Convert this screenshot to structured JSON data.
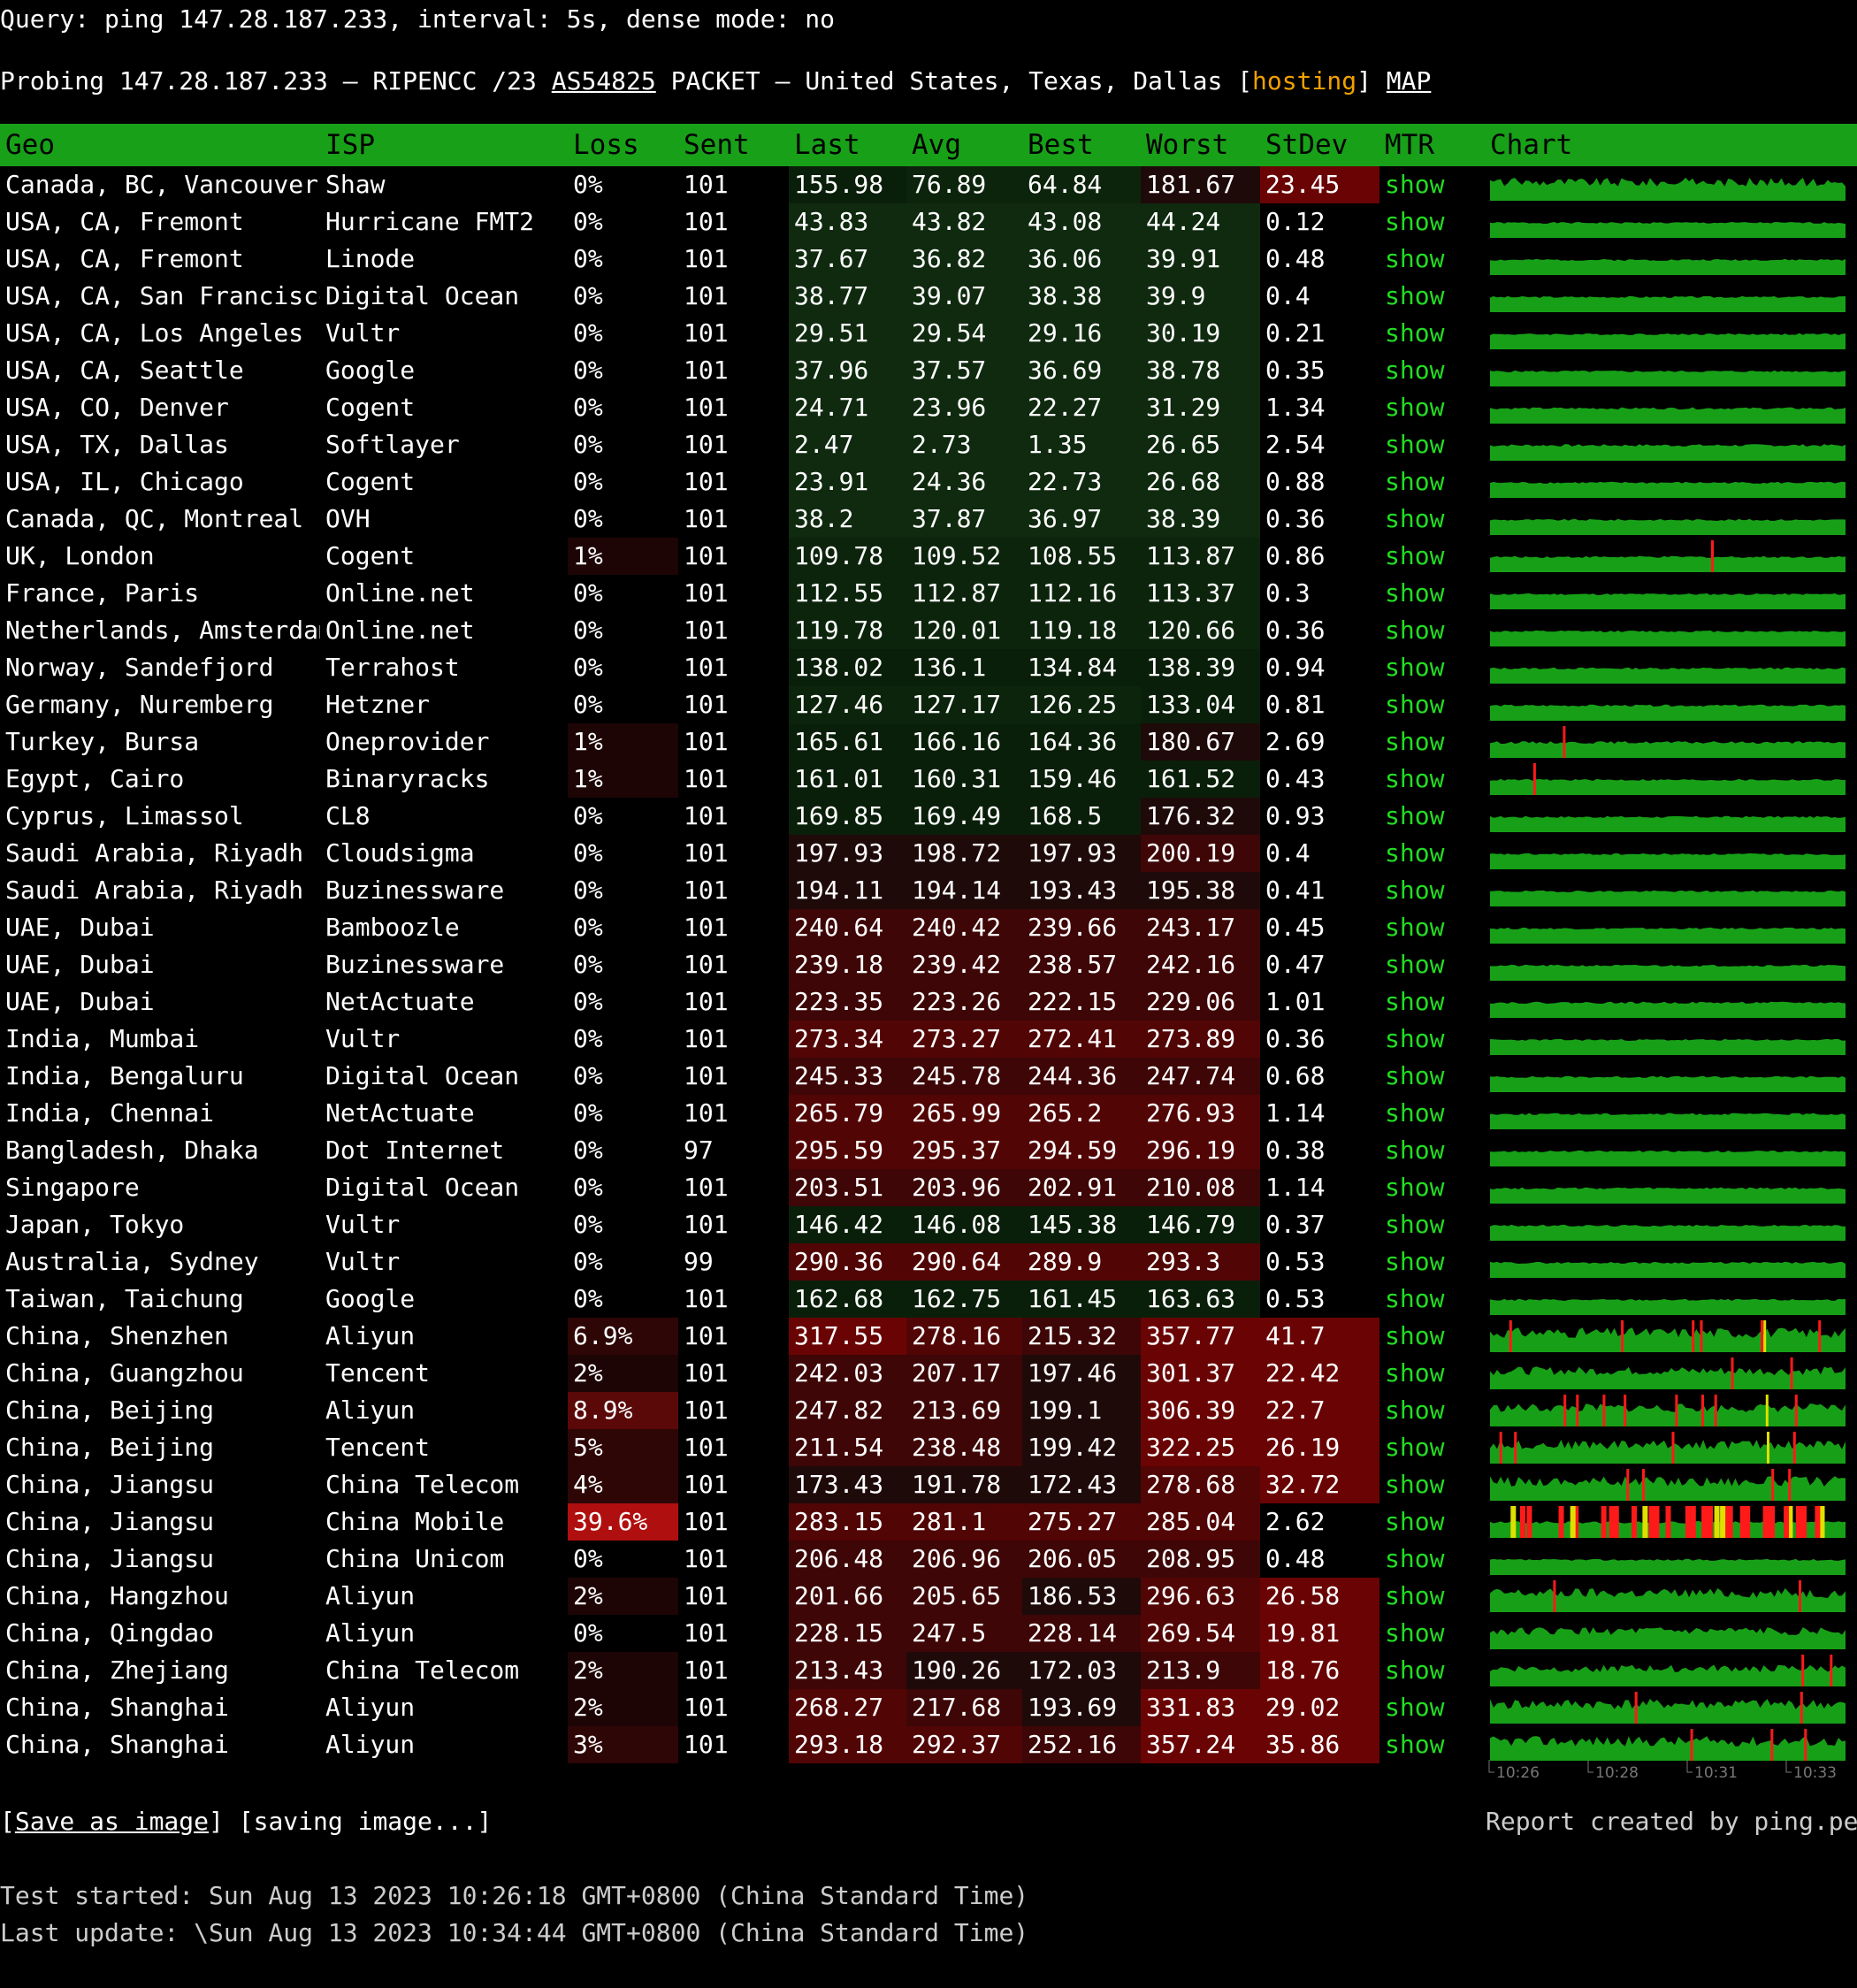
{
  "query": "Query: ping 147.28.187.233, interval: 5s, dense mode: no",
  "probe": {
    "prefix": "Probing 147.28.187.233 – RIPENCC /23 ",
    "asn": "AS54825",
    "middle": " PACKET – United States, Texas, Dallas [",
    "tag": "hosting",
    "after": "] ",
    "map": "MAP"
  },
  "columns": [
    "Geo",
    "ISP",
    "Loss",
    "Sent",
    "Last",
    "Avg",
    "Best",
    "Worst",
    "StDev",
    "MTR",
    "Chart"
  ],
  "rows": [
    [
      "Canada, BC, Vancouver",
      "Shaw",
      "0%",
      "101",
      "155.98",
      "76.89",
      "64.84",
      "181.67",
      "23.45",
      "show"
    ],
    [
      "USA, CA, Fremont",
      "Hurricane FMT2",
      "0%",
      "101",
      "43.83",
      "43.82",
      "43.08",
      "44.24",
      "0.12",
      "show"
    ],
    [
      "USA, CA, Fremont",
      "Linode",
      "0%",
      "101",
      "37.67",
      "36.82",
      "36.06",
      "39.91",
      "0.48",
      "show"
    ],
    [
      "USA, CA, San Francisco",
      "Digital Ocean",
      "0%",
      "101",
      "38.77",
      "39.07",
      "38.38",
      "39.9",
      "0.4",
      "show"
    ],
    [
      "USA, CA, Los Angeles",
      "Vultr",
      "0%",
      "101",
      "29.51",
      "29.54",
      "29.16",
      "30.19",
      "0.21",
      "show"
    ],
    [
      "USA, CA, Seattle",
      "Google",
      "0%",
      "101",
      "37.96",
      "37.57",
      "36.69",
      "38.78",
      "0.35",
      "show"
    ],
    [
      "USA, CO, Denver",
      "Cogent",
      "0%",
      "101",
      "24.71",
      "23.96",
      "22.27",
      "31.29",
      "1.34",
      "show"
    ],
    [
      "USA, TX, Dallas",
      "Softlayer",
      "0%",
      "101",
      "2.47",
      "2.73",
      "1.35",
      "26.65",
      "2.54",
      "show"
    ],
    [
      "USA, IL, Chicago",
      "Cogent",
      "0%",
      "101",
      "23.91",
      "24.36",
      "22.73",
      "26.68",
      "0.88",
      "show"
    ],
    [
      "Canada, QC, Montreal",
      "OVH",
      "0%",
      "101",
      "38.2",
      "37.87",
      "36.97",
      "38.39",
      "0.36",
      "show"
    ],
    [
      "UK, London",
      "Cogent",
      "1%",
      "101",
      "109.78",
      "109.52",
      "108.55",
      "113.87",
      "0.86",
      "show"
    ],
    [
      "France, Paris",
      "Online.net",
      "0%",
      "101",
      "112.55",
      "112.87",
      "112.16",
      "113.37",
      "0.3",
      "show"
    ],
    [
      "Netherlands, Amsterdam",
      "Online.net",
      "0%",
      "101",
      "119.78",
      "120.01",
      "119.18",
      "120.66",
      "0.36",
      "show"
    ],
    [
      "Norway, Sandefjord",
      "Terrahost",
      "0%",
      "101",
      "138.02",
      "136.1",
      "134.84",
      "138.39",
      "0.94",
      "show"
    ],
    [
      "Germany, Nuremberg",
      "Hetzner",
      "0%",
      "101",
      "127.46",
      "127.17",
      "126.25",
      "133.04",
      "0.81",
      "show"
    ],
    [
      "Turkey, Bursa",
      "Oneprovider",
      "1%",
      "101",
      "165.61",
      "166.16",
      "164.36",
      "180.67",
      "2.69",
      "show"
    ],
    [
      "Egypt, Cairo",
      "Binaryracks",
      "1%",
      "101",
      "161.01",
      "160.31",
      "159.46",
      "161.52",
      "0.43",
      "show"
    ],
    [
      "Cyprus, Limassol",
      "CL8",
      "0%",
      "101",
      "169.85",
      "169.49",
      "168.5",
      "176.32",
      "0.93",
      "show"
    ],
    [
      "Saudi Arabia, Riyadh",
      "Cloudsigma",
      "0%",
      "101",
      "197.93",
      "198.72",
      "197.93",
      "200.19",
      "0.4",
      "show"
    ],
    [
      "Saudi Arabia, Riyadh",
      "Buzinessware",
      "0%",
      "101",
      "194.11",
      "194.14",
      "193.43",
      "195.38",
      "0.41",
      "show"
    ],
    [
      "UAE, Dubai",
      "Bamboozle",
      "0%",
      "101",
      "240.64",
      "240.42",
      "239.66",
      "243.17",
      "0.45",
      "show"
    ],
    [
      "UAE, Dubai",
      "Buzinessware",
      "0%",
      "101",
      "239.18",
      "239.42",
      "238.57",
      "242.16",
      "0.47",
      "show"
    ],
    [
      "UAE, Dubai",
      "NetActuate",
      "0%",
      "101",
      "223.35",
      "223.26",
      "222.15",
      "229.06",
      "1.01",
      "show"
    ],
    [
      "India, Mumbai",
      "Vultr",
      "0%",
      "101",
      "273.34",
      "273.27",
      "272.41",
      "273.89",
      "0.36",
      "show"
    ],
    [
      "India, Bengaluru",
      "Digital Ocean",
      "0%",
      "101",
      "245.33",
      "245.78",
      "244.36",
      "247.74",
      "0.68",
      "show"
    ],
    [
      "India, Chennai",
      "NetActuate",
      "0%",
      "101",
      "265.79",
      "265.99",
      "265.2",
      "276.93",
      "1.14",
      "show"
    ],
    [
      "Bangladesh, Dhaka",
      "Dot Internet",
      "0%",
      "97",
      "295.59",
      "295.37",
      "294.59",
      "296.19",
      "0.38",
      "show"
    ],
    [
      "Singapore",
      "Digital Ocean",
      "0%",
      "101",
      "203.51",
      "203.96",
      "202.91",
      "210.08",
      "1.14",
      "show"
    ],
    [
      "Japan, Tokyo",
      "Vultr",
      "0%",
      "101",
      "146.42",
      "146.08",
      "145.38",
      "146.79",
      "0.37",
      "show"
    ],
    [
      "Australia, Sydney",
      "Vultr",
      "0%",
      "99",
      "290.36",
      "290.64",
      "289.9",
      "293.3",
      "0.53",
      "show"
    ],
    [
      "Taiwan, Taichung",
      "Google",
      "0%",
      "101",
      "162.68",
      "162.75",
      "161.45",
      "163.63",
      "0.53",
      "show"
    ],
    [
      "China, Shenzhen",
      "Aliyun",
      "6.9%",
      "101",
      "317.55",
      "278.16",
      "215.32",
      "357.77",
      "41.7",
      "show"
    ],
    [
      "China, Guangzhou",
      "Tencent",
      "2%",
      "101",
      "242.03",
      "207.17",
      "197.46",
      "301.37",
      "22.42",
      "show"
    ],
    [
      "China, Beijing",
      "Aliyun",
      "8.9%",
      "101",
      "247.82",
      "213.69",
      "199.1",
      "306.39",
      "22.7",
      "show"
    ],
    [
      "China, Beijing",
      "Tencent",
      "5%",
      "101",
      "211.54",
      "238.48",
      "199.42",
      "322.25",
      "26.19",
      "show"
    ],
    [
      "China, Jiangsu",
      "China Telecom",
      "4%",
      "101",
      "173.43",
      "191.78",
      "172.43",
      "278.68",
      "32.72",
      "show"
    ],
    [
      "China, Jiangsu",
      "China Mobile",
      "39.6%",
      "101",
      "283.15",
      "281.1",
      "275.27",
      "285.04",
      "2.62",
      "show"
    ],
    [
      "China, Jiangsu",
      "China Unicom",
      "0%",
      "101",
      "206.48",
      "206.96",
      "206.05",
      "208.95",
      "0.48",
      "show"
    ],
    [
      "China, Hangzhou",
      "Aliyun",
      "2%",
      "101",
      "201.66",
      "205.65",
      "186.53",
      "296.63",
      "26.58",
      "show"
    ],
    [
      "China, Qingdao",
      "Aliyun",
      "0%",
      "101",
      "228.15",
      "247.5",
      "228.14",
      "269.54",
      "19.81",
      "show"
    ],
    [
      "China, Zhejiang",
      "China Telecom",
      "2%",
      "101",
      "213.43",
      "190.26",
      "172.03",
      "213.9",
      "18.76",
      "show"
    ],
    [
      "China, Shanghai",
      "Aliyun",
      "2%",
      "101",
      "268.27",
      "217.68",
      "193.69",
      "331.83",
      "29.02",
      "show"
    ],
    [
      "China, Shanghai",
      "Aliyun",
      "3%",
      "101",
      "293.18",
      "292.37",
      "252.16",
      "357.24",
      "35.86",
      "show"
    ]
  ],
  "axis_ticks": [
    "10:26",
    "10:28",
    "10:31",
    "10:33"
  ],
  "footer": {
    "save_open": "[",
    "save_link": "Save as image",
    "save_close": "] [saving image...]",
    "report": "Report created by ping.pe",
    "started": "Test started: Sun Aug 13 2023 10:26:18 GMT+0800 (China Standard Time)",
    "updated": "Last update: \\Sun Aug 13 2023 10:34:44 GMT+0800 (China Standard Time)"
  },
  "colors": {
    "header_green": "#18a018",
    "chart_green": "#17a017",
    "loss_red": "#ff1a1a",
    "loss_yellow": "#e0e000",
    "link_green": "#22dd22",
    "hosting_orange": "#f0a000"
  }
}
